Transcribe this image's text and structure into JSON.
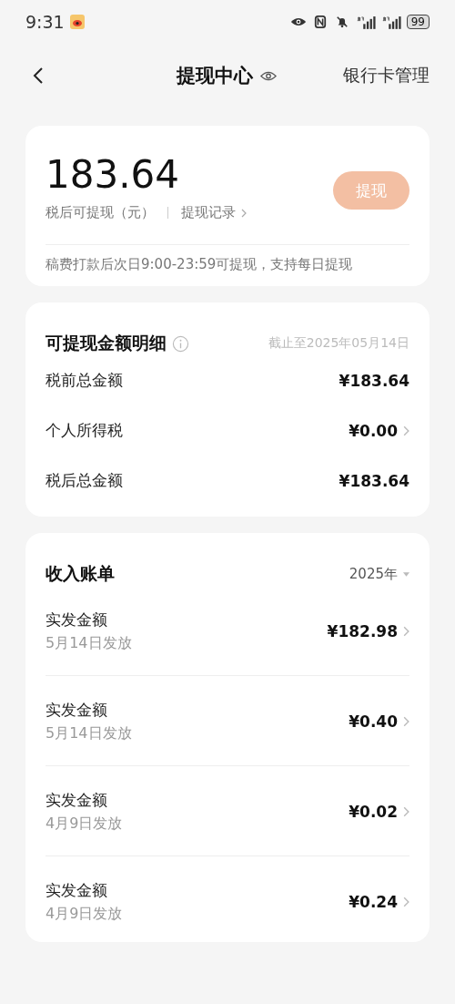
{
  "status_bar": {
    "time": "9:31",
    "battery": "99"
  },
  "header": {
    "title": "提现中心",
    "action": "银行卡管理"
  },
  "balance": {
    "amount": "183.64",
    "label": "税后可提现（元）",
    "records_link": "提现记录",
    "withdraw_button": {
      "label": "提现",
      "disabled": true
    },
    "note": "稿费打款后次日9:00-23:59可提现，支持每日提现"
  },
  "details": {
    "title": "可提现金额明细",
    "as_of": "截止至2025年05月14日",
    "rows": [
      {
        "label": "税前总金额",
        "value": "¥183.64",
        "arrow": false
      },
      {
        "label": "个人所得税",
        "value": "¥0.00",
        "arrow": true
      },
      {
        "label": "税后总金额",
        "value": "¥183.64",
        "arrow": false
      }
    ]
  },
  "income": {
    "title": "收入账单",
    "year": "2025年",
    "rows": [
      {
        "label": "实发金额",
        "date": "5月14日发放",
        "amount": "¥182.98"
      },
      {
        "label": "实发金额",
        "date": "5月14日发放",
        "amount": "¥0.40"
      },
      {
        "label": "实发金额",
        "date": "4月9日发放",
        "amount": "¥0.02"
      },
      {
        "label": "实发金额",
        "date": "4月9日发放",
        "amount": "¥0.24"
      }
    ]
  }
}
